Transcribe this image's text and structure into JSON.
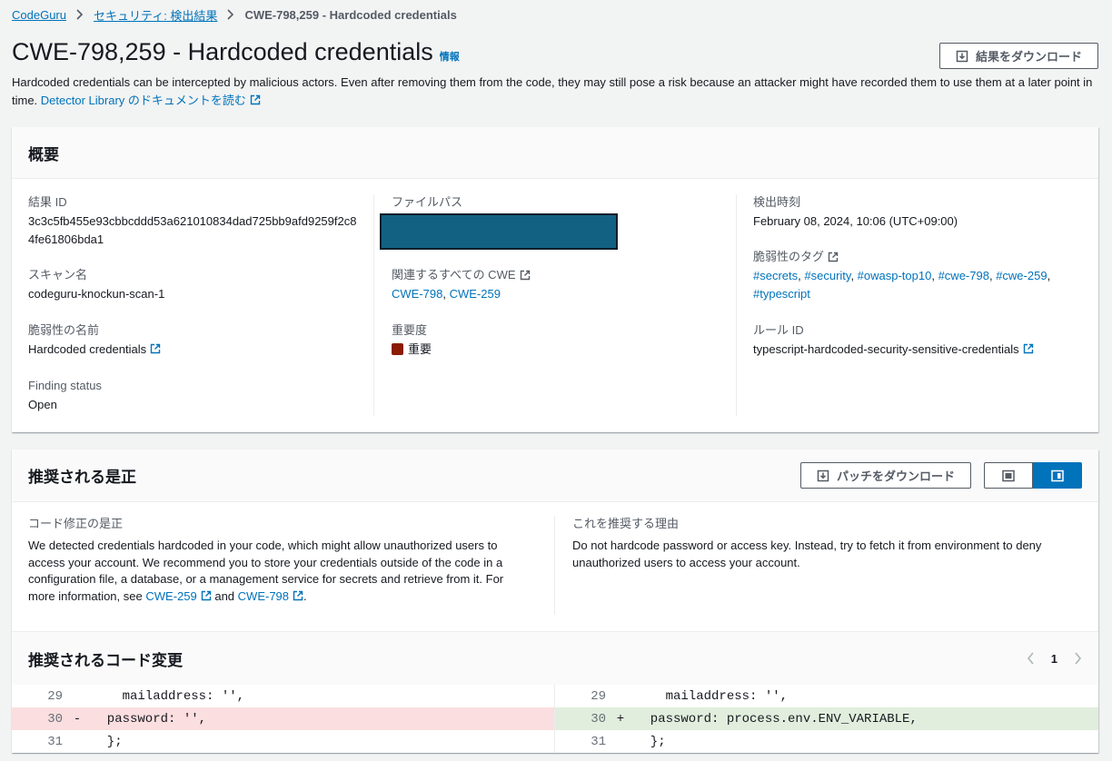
{
  "breadcrumb": {
    "items": [
      "CodeGuru",
      "セキュリティ: 検出結果"
    ],
    "current": "CWE-798,259 - Hardcoded credentials"
  },
  "header": {
    "title": "CWE-798,259 - Hardcoded credentials",
    "info_label": "情報",
    "download_button": "結果をダウンロード",
    "description": "Hardcoded credentials can be intercepted by malicious actors. Even after removing them from the code, they may still pose a risk because an attacker might have recorded them to use them at a later point in time.",
    "doc_link": "Detector Library のドキュメントを読む"
  },
  "overview": {
    "title": "概要",
    "result_id_label": "結果 ID",
    "result_id": "3c3c5fb455e93cbbcddd53a621010834dad725bb9afd9259f2c84fe61806bda1",
    "scan_name_label": "スキャン名",
    "scan_name": "codeguru-knockun-scan-1",
    "vuln_name_label": "脆弱性の名前",
    "vuln_name": "Hardcoded credentials",
    "finding_status_label": "Finding status",
    "finding_status": "Open",
    "file_path_label": "ファイルパス",
    "related_cwe_label": "関連するすべての CWE",
    "cwe_links": [
      "CWE-798",
      "CWE-259"
    ],
    "severity_label": "重要度",
    "severity": "重要",
    "detected_at_label": "検出時刻",
    "detected_at": "February 08, 2024, 10:06 (UTC+09:00)",
    "tags_label": "脆弱性のタグ",
    "tags": [
      "#secrets",
      "#security",
      "#owasp-top10",
      "#cwe-798",
      "#cwe-259",
      "#typescript"
    ],
    "rule_id_label": "ルール ID",
    "rule_id": "typescript-hardcoded-security-sensitive-credentials"
  },
  "remediation": {
    "title": "推奨される是正",
    "download_patch_button": "パッチをダウンロード",
    "code_fix_label": "コード修正の是正",
    "code_fix_text": "We detected credentials hardcoded in your code, which might allow unauthorized users to access your account. We recommend you to store your credentials outside of the code in a configuration file, a database, or a management service for secrets and retrieve from it. For more information, see",
    "code_fix_link1": "CWE-259",
    "code_fix_and": "and",
    "code_fix_link2": "CWE-798",
    "code_fix_end": ".",
    "reason_label": "これを推奨する理由",
    "reason_text": "Do not hardcode password or access key. Instead, try to fetch it from environment to deny unauthorized users to access your account.",
    "code_changes_title": "推奨されるコード変更",
    "page": "1",
    "diff_left": [
      {
        "ln": "29",
        "marker": "",
        "code": "    mailaddress: '',"
      },
      {
        "ln": "30",
        "marker": "-",
        "code": "  password: '',"
      },
      {
        "ln": "31",
        "marker": "",
        "code": "  };"
      }
    ],
    "diff_right": [
      {
        "ln": "29",
        "marker": "",
        "code": "    mailaddress: '',"
      },
      {
        "ln": "30",
        "marker": "+",
        "code": "  password: process.env.ENV_VARIABLE,"
      },
      {
        "ln": "31",
        "marker": "",
        "code": "  };"
      }
    ]
  },
  "colors": {
    "link": "#0073bb",
    "severity_critical": "#8a1c04",
    "diff_deleted": "#fbdedf",
    "diff_added": "#e1eedd"
  }
}
